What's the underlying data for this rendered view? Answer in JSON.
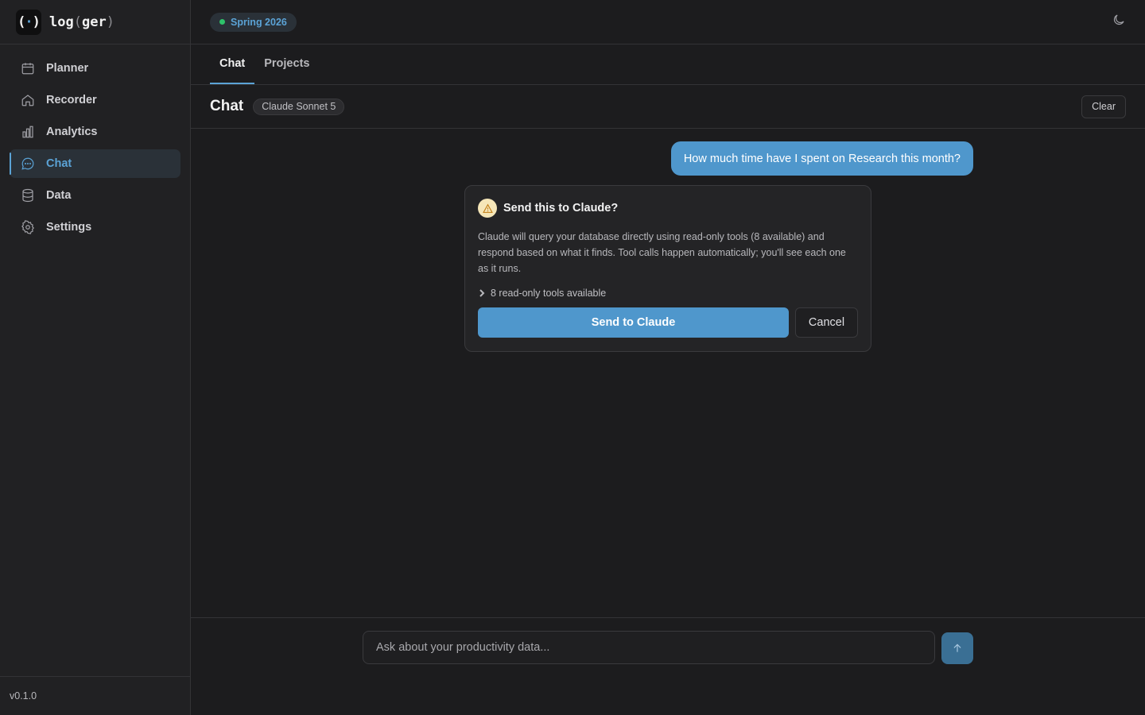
{
  "app": {
    "logo_glyph_left": "(",
    "logo_glyph_dot": "·",
    "logo_glyph_right": ")",
    "name_main": "log",
    "name_paren_open": "(",
    "name_inner": "ger",
    "name_paren_close": ")",
    "version": "v0.1.0"
  },
  "sidebar": {
    "items": [
      {
        "label": "Planner",
        "icon": "calendar-icon",
        "active": false
      },
      {
        "label": "Recorder",
        "icon": "home-icon",
        "active": false
      },
      {
        "label": "Analytics",
        "icon": "bar-chart-icon",
        "active": false
      },
      {
        "label": "Chat",
        "icon": "chat-bubble-icon",
        "active": true
      },
      {
        "label": "Data",
        "icon": "database-icon",
        "active": false
      },
      {
        "label": "Settings",
        "icon": "gear-icon",
        "active": false
      }
    ]
  },
  "topbar": {
    "semester": "Spring 2026",
    "theme_icon": "moon-icon"
  },
  "tabs": [
    {
      "label": "Chat",
      "active": true
    },
    {
      "label": "Projects",
      "active": false
    }
  ],
  "chat": {
    "title": "Chat",
    "model": "Claude Sonnet 5",
    "clear_label": "Clear",
    "user_message": "How much time have I spent on Research this month?"
  },
  "confirm": {
    "title": "Send this to Claude?",
    "description": "Claude will query your database directly using read-only tools (8 available) and respond based on what it finds. Tool calls happen automatically; you'll see each one as it runs.",
    "tools_toggle": "8 read-only tools available",
    "send_label": "Send to Claude",
    "cancel_label": "Cancel"
  },
  "composer": {
    "placeholder": "Ask about your productivity data..."
  },
  "colors": {
    "accent": "#5ba3d6",
    "user_bubble": "#4f97cc",
    "live_dot": "#2ec26a",
    "warning": "#f5e6b8"
  }
}
